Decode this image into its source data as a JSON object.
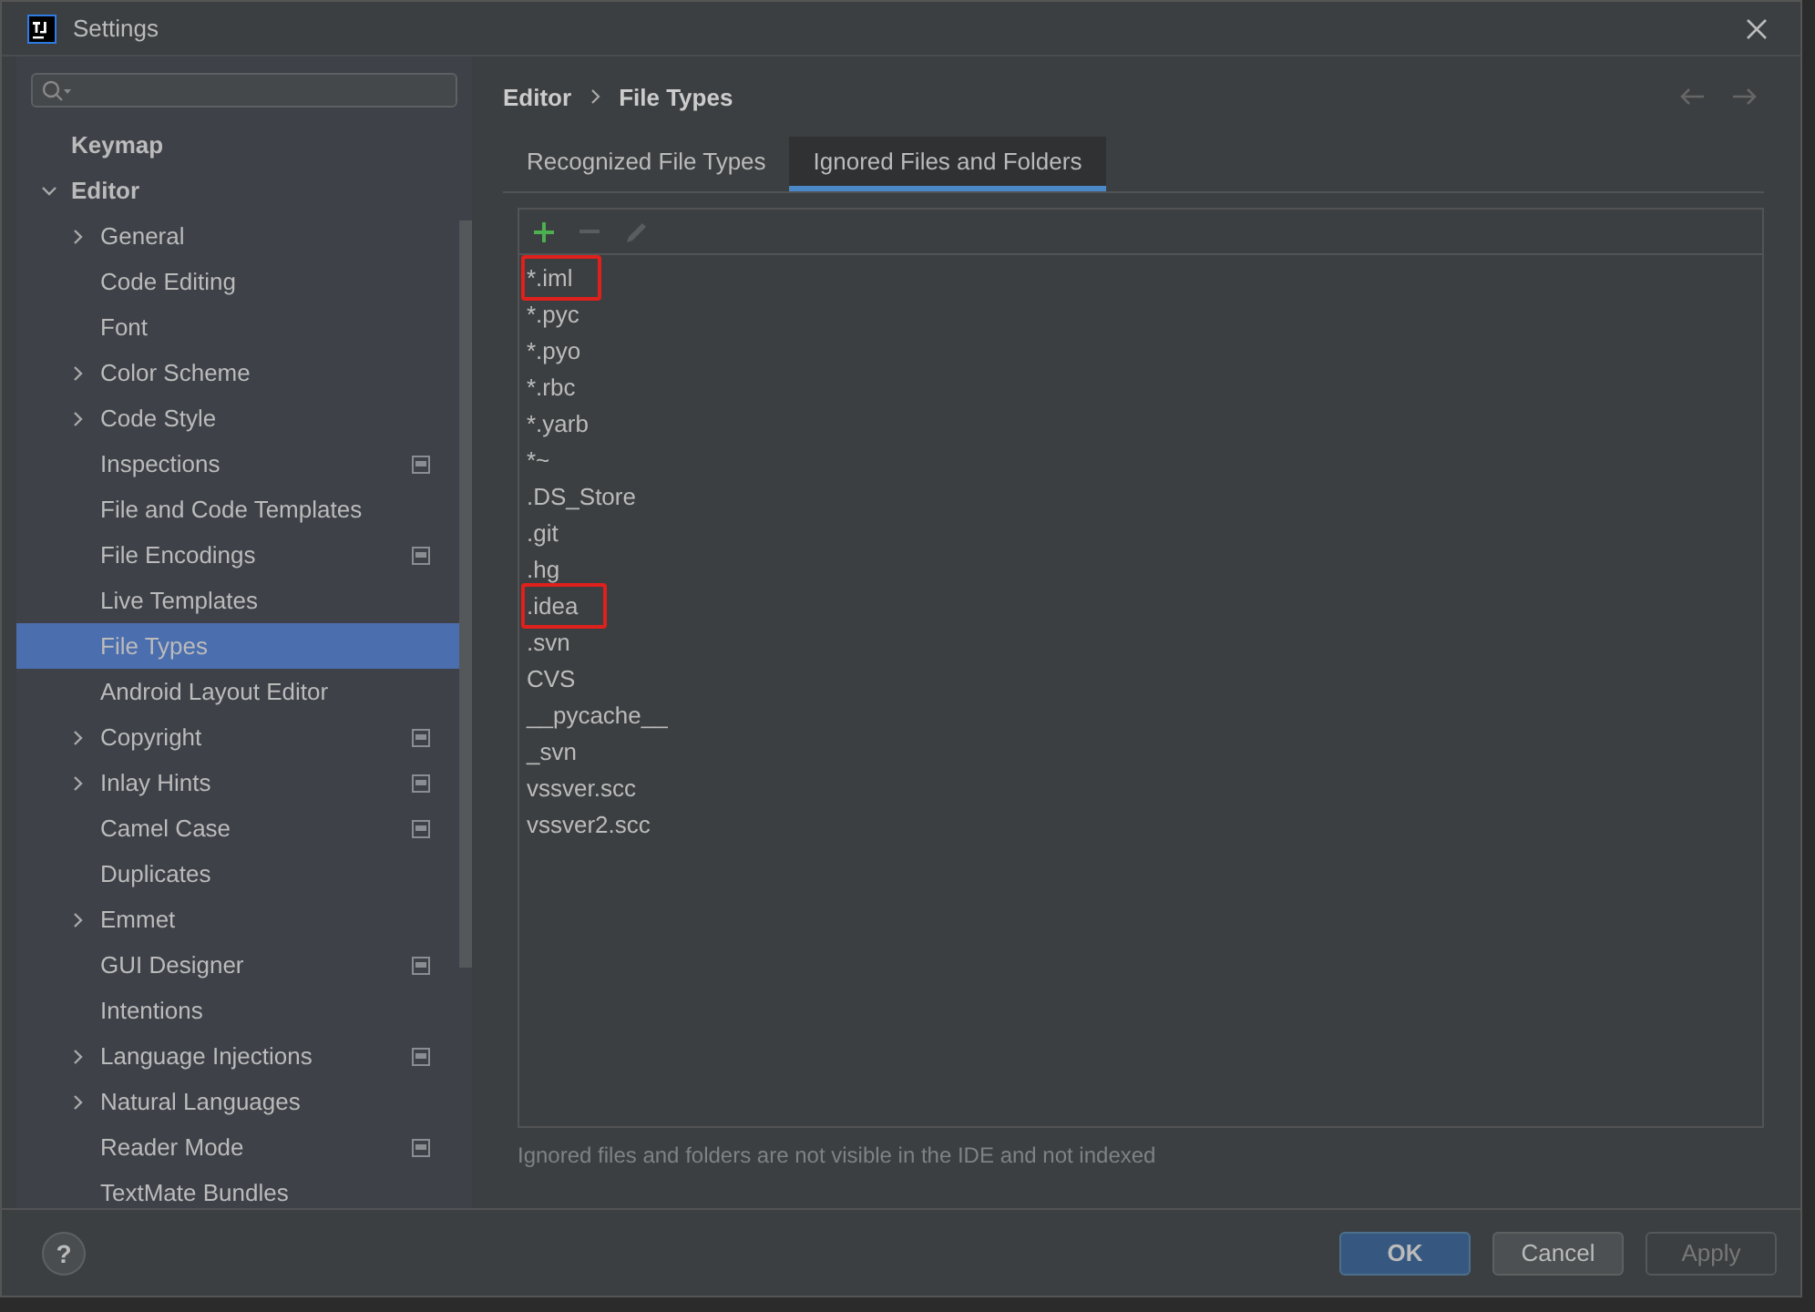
{
  "window": {
    "title": "Settings"
  },
  "sidebar": {
    "items": [
      {
        "label": "Keymap",
        "kind": "page",
        "selected": false,
        "project_scope": false
      },
      {
        "label": "Editor",
        "kind": "group",
        "expanded": true,
        "selected": false,
        "project_scope": false,
        "children": [
          {
            "label": "General",
            "kind": "group",
            "expanded": false,
            "selected": false,
            "project_scope": false
          },
          {
            "label": "Code Editing",
            "kind": "page",
            "selected": false,
            "project_scope": false
          },
          {
            "label": "Font",
            "kind": "page",
            "selected": false,
            "project_scope": false
          },
          {
            "label": "Color Scheme",
            "kind": "group",
            "expanded": false,
            "selected": false,
            "project_scope": false
          },
          {
            "label": "Code Style",
            "kind": "group",
            "expanded": false,
            "selected": false,
            "project_scope": false
          },
          {
            "label": "Inspections",
            "kind": "page",
            "selected": false,
            "project_scope": true
          },
          {
            "label": "File and Code Templates",
            "kind": "page",
            "selected": false,
            "project_scope": false
          },
          {
            "label": "File Encodings",
            "kind": "page",
            "selected": false,
            "project_scope": true
          },
          {
            "label": "Live Templates",
            "kind": "page",
            "selected": false,
            "project_scope": false
          },
          {
            "label": "File Types",
            "kind": "page",
            "selected": true,
            "project_scope": false
          },
          {
            "label": "Android Layout Editor",
            "kind": "page",
            "selected": false,
            "project_scope": false
          },
          {
            "label": "Copyright",
            "kind": "group",
            "expanded": false,
            "selected": false,
            "project_scope": true
          },
          {
            "label": "Inlay Hints",
            "kind": "group",
            "expanded": false,
            "selected": false,
            "project_scope": true
          },
          {
            "label": "Camel Case",
            "kind": "page",
            "selected": false,
            "project_scope": true
          },
          {
            "label": "Duplicates",
            "kind": "page",
            "selected": false,
            "project_scope": false
          },
          {
            "label": "Emmet",
            "kind": "group",
            "expanded": false,
            "selected": false,
            "project_scope": false
          },
          {
            "label": "GUI Designer",
            "kind": "page",
            "selected": false,
            "project_scope": true
          },
          {
            "label": "Intentions",
            "kind": "page",
            "selected": false,
            "project_scope": false
          },
          {
            "label": "Language Injections",
            "kind": "group",
            "expanded": false,
            "selected": false,
            "project_scope": true
          },
          {
            "label": "Natural Languages",
            "kind": "group",
            "expanded": false,
            "selected": false,
            "project_scope": false
          },
          {
            "label": "Reader Mode",
            "kind": "page",
            "selected": false,
            "project_scope": true
          },
          {
            "label": "TextMate Bundles",
            "kind": "page",
            "selected": false,
            "project_scope": false
          }
        ]
      }
    ]
  },
  "breadcrumb": [
    "Editor",
    "File Types"
  ],
  "tabs": [
    {
      "label": "Recognized File Types",
      "selected": false
    },
    {
      "label": "Ignored Files and Folders",
      "selected": true
    }
  ],
  "toolbar": [
    {
      "kind": "add",
      "disabled": false
    },
    {
      "kind": "remove",
      "disabled": true
    },
    {
      "kind": "edit",
      "disabled": true
    }
  ],
  "ignored": [
    {
      "pattern": "*.iml",
      "highlighted": true
    },
    {
      "pattern": "*.pyc",
      "highlighted": false
    },
    {
      "pattern": "*.pyo",
      "highlighted": false
    },
    {
      "pattern": "*.rbc",
      "highlighted": false
    },
    {
      "pattern": "*.yarb",
      "highlighted": false
    },
    {
      "pattern": "*~",
      "highlighted": false
    },
    {
      "pattern": ".DS_Store",
      "highlighted": false
    },
    {
      "pattern": ".git",
      "highlighted": false
    },
    {
      "pattern": ".hg",
      "highlighted": false
    },
    {
      "pattern": ".idea",
      "highlighted": true
    },
    {
      "pattern": ".svn",
      "highlighted": false
    },
    {
      "pattern": "CVS",
      "highlighted": false
    },
    {
      "pattern": "__pycache__",
      "highlighted": false
    },
    {
      "pattern": "_svn",
      "highlighted": false
    },
    {
      "pattern": "vssver.scc",
      "highlighted": false
    },
    {
      "pattern": "vssver2.scc",
      "highlighted": false
    }
  ],
  "note": "Ignored files and folders are not visible in the IDE and not indexed",
  "help": "?",
  "buttons": [
    {
      "label": "OK",
      "kind": "default",
      "disabled": false
    },
    {
      "label": "Cancel",
      "kind": "normal",
      "disabled": false
    },
    {
      "label": "Apply",
      "kind": "normal",
      "disabled": true
    }
  ]
}
